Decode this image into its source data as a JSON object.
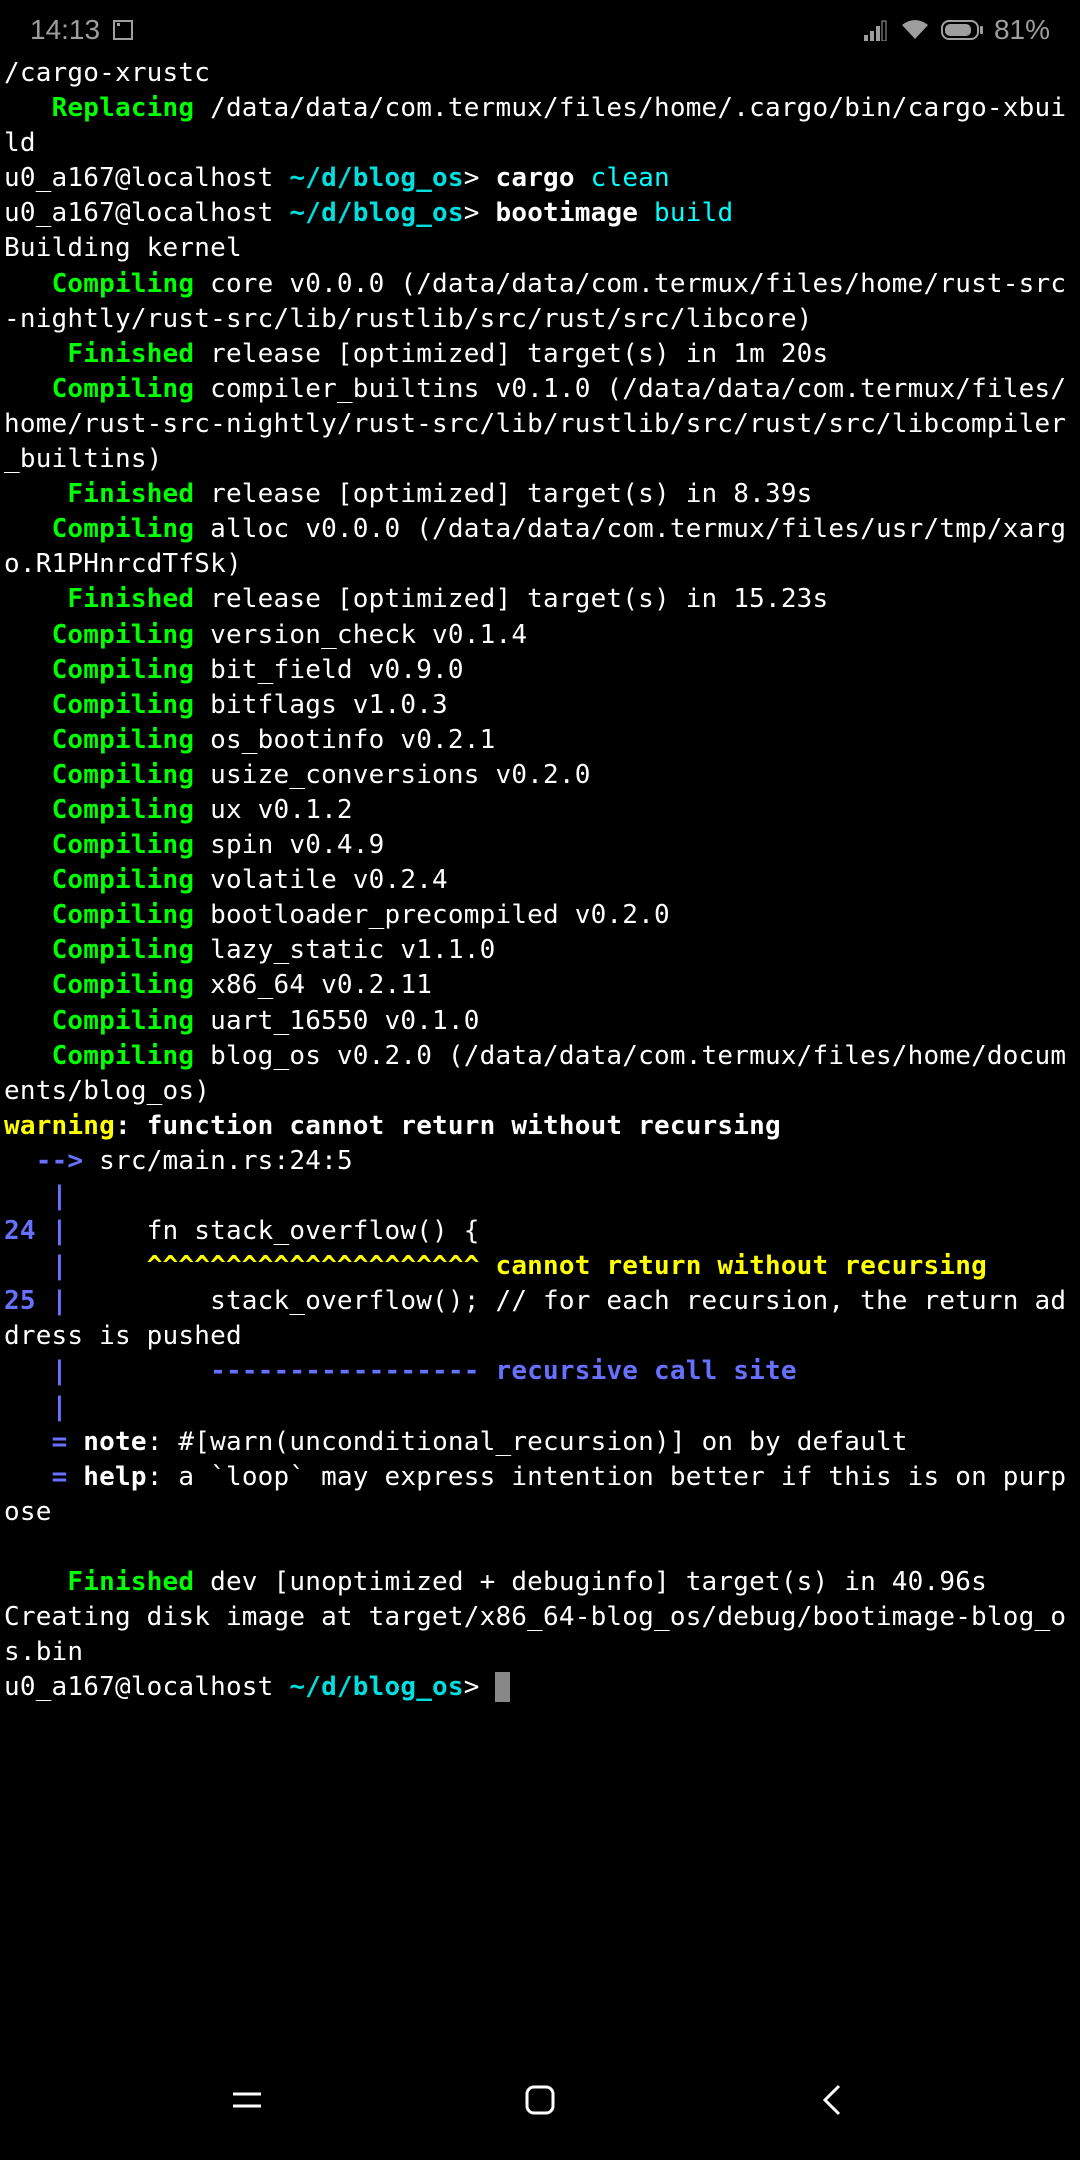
{
  "status_bar": {
    "time": "14:13",
    "battery_pct": "81%"
  },
  "terminal": {
    "line1": "/cargo-xrustc",
    "replacing_label": "   Replacing",
    "replacing_path": " /data/data/com.termux/files/home/.cargo/bin/cargo-xbuild",
    "prompt_user": "u0_a167@localhost ",
    "prompt_path": "~/d/blog_os",
    "prompt_sep": "> ",
    "cmd1_a": "cargo ",
    "cmd1_b": "clean",
    "cmd2_a": "bootimage ",
    "cmd2_b": "build",
    "building": "Building kernel",
    "compiling_label": "   Compiling",
    "finished_label": "    Finished",
    "core": " core v0.0.0 (/data/data/com.termux/files/home/rust-src-nightly/rust-src/lib/rustlib/src/rust/src/libcore)",
    "fin1": " release [optimized] target(s) in 1m 20s",
    "comp_builtins": " compiler_builtins v0.1.0 (/data/data/com.termux/files/home/rust-src-nightly/rust-src/lib/rustlib/src/rust/src/libcompiler_builtins)",
    "fin2": " release [optimized] target(s) in 8.39s",
    "alloc": " alloc v0.0.0 (/data/data/com.termux/files/usr/tmp/xargo.R1PHnrcdTfSk)",
    "fin3": " release [optimized] target(s) in 15.23s",
    "vcheck": " version_check v0.1.4",
    "bitfield": " bit_field v0.9.0",
    "bitflags": " bitflags v1.0.3",
    "osboot": " os_bootinfo v0.2.1",
    "usize": " usize_conversions v0.2.0",
    "ux": " ux v0.1.2",
    "spin": " spin v0.4.9",
    "volatile": " volatile v0.2.4",
    "bootloader": " bootloader_precompiled v0.2.0",
    "lazy": " lazy_static v1.1.0",
    "x86": " x86_64 v0.2.11",
    "uart": " uart_16550 v0.1.0",
    "blogos": " blog_os v0.2.0 (/data/data/com.termux/files/home/documents/blog_os)",
    "warning_kw": "warning",
    "warning_msg": ": function cannot return without recursing",
    "warn_arrow": "  --> ",
    "warn_loc": "src/main.rs:24:5",
    "pipe_only": "   |",
    "ln24_num": "24 ",
    "pipe": "|",
    "ln24_code": "     fn stack_overflow() {",
    "caret_pre": "   |     ",
    "carets": "^^^^^^^^^^^^^^^^^^^^^ ",
    "caret_msg": "cannot return without recursing",
    "ln25_num": "25 ",
    "ln25_code": "         stack_overflow(); // for each recursion, the return address is pushed",
    "dash_pre": "   |         ",
    "dashes": "----------------- ",
    "dash_msg": "recursive call site",
    "eq_pre": "   = ",
    "note_kw": "note",
    "note_msg": ": #[warn(unconditional_recursion)] on by default",
    "help_kw": "help",
    "help_msg": ": a `loop` may express intention better if this is on purpose",
    "fin4": " dev [unoptimized + debuginfo] target(s) in 40.96s",
    "disk": "Creating disk image at target/x86_64-blog_os/debug/bootimage-blog_os.bin"
  }
}
